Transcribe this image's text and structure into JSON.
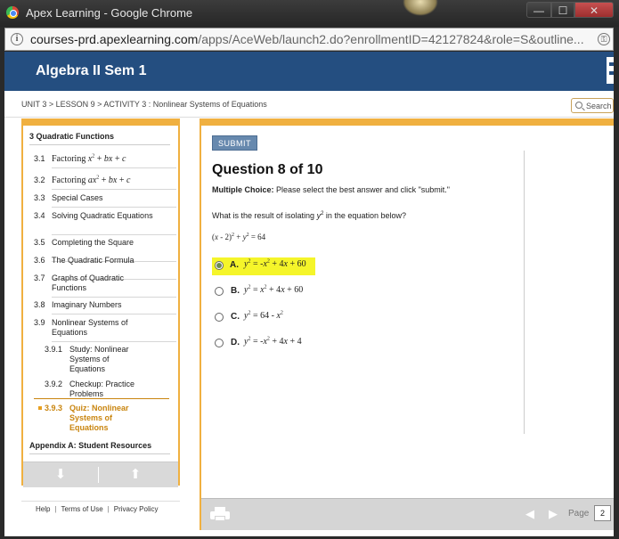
{
  "window": {
    "title": "Apex Learning - Google Chrome",
    "minimize": "—",
    "maximize": "☐",
    "close": "✕"
  },
  "address": {
    "host": "courses-prd.apexlearning.com",
    "path": "/apps/AceWeb/launch2.do?enrollmentID=42127824&role=S&outline..."
  },
  "header": {
    "course_title": "Algebra II Sem 1"
  },
  "breadcrumb": "UNIT 3 > LESSON 9 > ACTIVITY 3 : Nonlinear Systems of Equations",
  "search": {
    "label": "Search"
  },
  "sidebar": {
    "heading": "3   Quadratic Functions",
    "items": [
      {
        "num": "3.1",
        "label_html": "Factoring <i>x</i><sup>2</sup> + <i>bx</i> + <i>c</i>"
      },
      {
        "num": "3.2",
        "label_html": "Factoring <i>ax</i><sup>2</sup> + <i>bx</i> + <i>c</i>"
      },
      {
        "num": "3.3",
        "label": "Special Cases"
      },
      {
        "num": "3.4",
        "label": "Solving Quadratic Equations"
      },
      {
        "num": "3.5",
        "label": "Completing the Square"
      },
      {
        "num": "3.6",
        "label": "The Quadratic Formula"
      },
      {
        "num": "3.7",
        "label": "Graphs of Quadratic Functions"
      },
      {
        "num": "3.8",
        "label": "Imaginary Numbers"
      },
      {
        "num": "3.9",
        "label": "Nonlinear Systems of Equations"
      }
    ],
    "subitems": [
      {
        "num": "3.9.1",
        "label": "Study: Nonlinear Systems of Equations"
      },
      {
        "num": "3.9.2",
        "label": "Checkup: Practice Problems"
      },
      {
        "num": "3.9.3",
        "label": "Quiz: Nonlinear Systems of Equations"
      }
    ],
    "appendix": "Appendix A: Student Resources",
    "down_arrow": "⬇",
    "up_arrow": "⬆"
  },
  "footer_links": [
    "Help",
    "Terms of Use",
    "Privacy Policy"
  ],
  "quiz": {
    "submit_label": "SUBMIT",
    "question_title": "Question 8 of 10",
    "type_label": "Multiple Choice:",
    "type_instructions": "Please select the best answer and click \"submit.\"",
    "prompt": "What is the result of isolating <i>y</i><sup>2</sup> in the equation below?",
    "equation": "(<i>x</i> - 2)<sup>2</sup> + <i>y</i><sup>2</sup> = 64",
    "choices": [
      {
        "letter": "A.",
        "expr": "<i>y</i><sup>2</sup> = -<i>x</i><sup>2</sup> + 4<i>x</i> + 60",
        "selected": true
      },
      {
        "letter": "B.",
        "expr": "<i>y</i><sup>2</sup> = <i>x</i><sup>2</sup> + 4<i>x</i> + 60",
        "selected": false
      },
      {
        "letter": "C.",
        "expr": "<i>y</i><sup>2</sup> = 64 - <i>x</i><sup>2</sup>",
        "selected": false
      },
      {
        "letter": "D.",
        "expr": "<i>y</i><sup>2</sup> = -<i>x</i><sup>2</sup> + 4<i>x</i> + 4",
        "selected": false
      }
    ]
  },
  "pager": {
    "page_label": "Page",
    "page_value": "2",
    "prev_arrow": "◀",
    "next_arrow": "▶"
  },
  "colors": {
    "header_bg": "#244e80",
    "accent_orange": "#f0b040",
    "highlight_yellow": "#f5f52a",
    "active_nav": "#c9850f"
  }
}
